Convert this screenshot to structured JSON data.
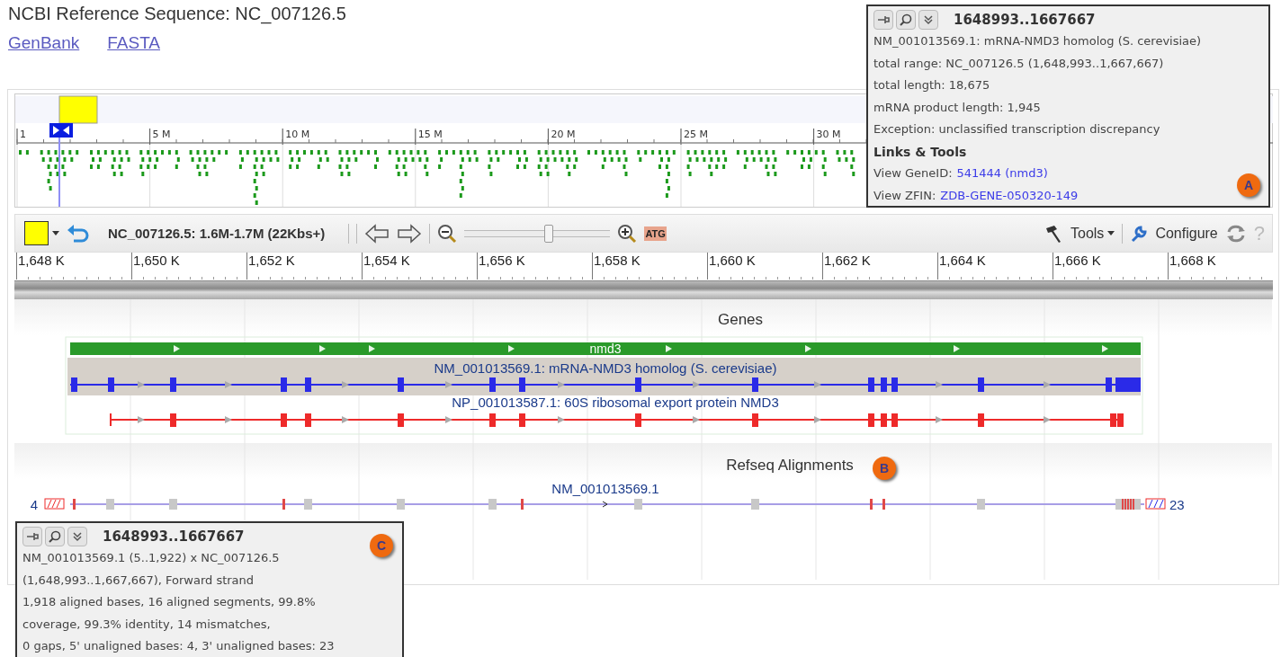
{
  "header": {
    "title": "NCBI Reference Sequence: NC_007126.5",
    "links": [
      "GenBank",
      "FASTA"
    ]
  },
  "overview": {
    "ticks": [
      "1",
      "5 M",
      "10 M",
      "15 M",
      "20 M",
      "25 M",
      "30 M"
    ]
  },
  "toolbar": {
    "location": "NC_007126.5: 1.6M-1.7M (22Kbs+)",
    "zoom": {
      "level": 0.58
    },
    "sequence_icon": "ATG",
    "tools": "Tools",
    "configure": "Configure",
    "help": "?"
  },
  "ruler": {
    "ticks": [
      "1,648 K",
      "1,650 K",
      "1,652 K",
      "1,654 K",
      "1,656 K",
      "1,658 K",
      "1,660 K",
      "1,662 K",
      "1,664 K",
      "1,666 K",
      "1,668 K"
    ]
  },
  "genes_track": {
    "title": "Genes",
    "gene": "nmd3",
    "mrna": "NM_001013569.1: mRNA-NMD3 homolog (S. cerevisiae)",
    "protein": "NP_001013587.1: 60S ribosomal export protein NMD3"
  },
  "alignments_track": {
    "title": "Refseq Alignments",
    "label": "NM_001013569.1",
    "left_count": "4",
    "right_count": "23",
    "badge": "B"
  },
  "tooltip_a": {
    "title": "1648993..1667667",
    "lines": [
      "NM_001013569.1: mRNA-NMD3 homolog (S. cerevisiae)",
      "total range: NC_007126.5 (1,648,993..1,667,667)",
      "total length: 18,675",
      "mRNA product length: 1,945",
      "Exception: unclassified transcription discrepancy"
    ],
    "section": "Links & Tools",
    "links": [
      {
        "label": "View GeneID:",
        "link": "541444 (nmd3)"
      },
      {
        "label": "View ZFIN:",
        "link": "ZDB-GENE-050320-149"
      }
    ],
    "badge": "A"
  },
  "tooltip_c": {
    "title": "1648993..1667667",
    "lines": [
      "NM_001013569.1 (5..1,922) x NC_007126.5",
      "(1,648,993..1,667,667), Forward strand",
      "1,918 aligned bases, 16 aligned segments, 99.8%",
      "coverage, 99.3% identity, 14 mismatches,",
      "0 gaps, 5' unaligned bases: 4, 3' unaligned bases: 23"
    ],
    "badge": "C"
  }
}
